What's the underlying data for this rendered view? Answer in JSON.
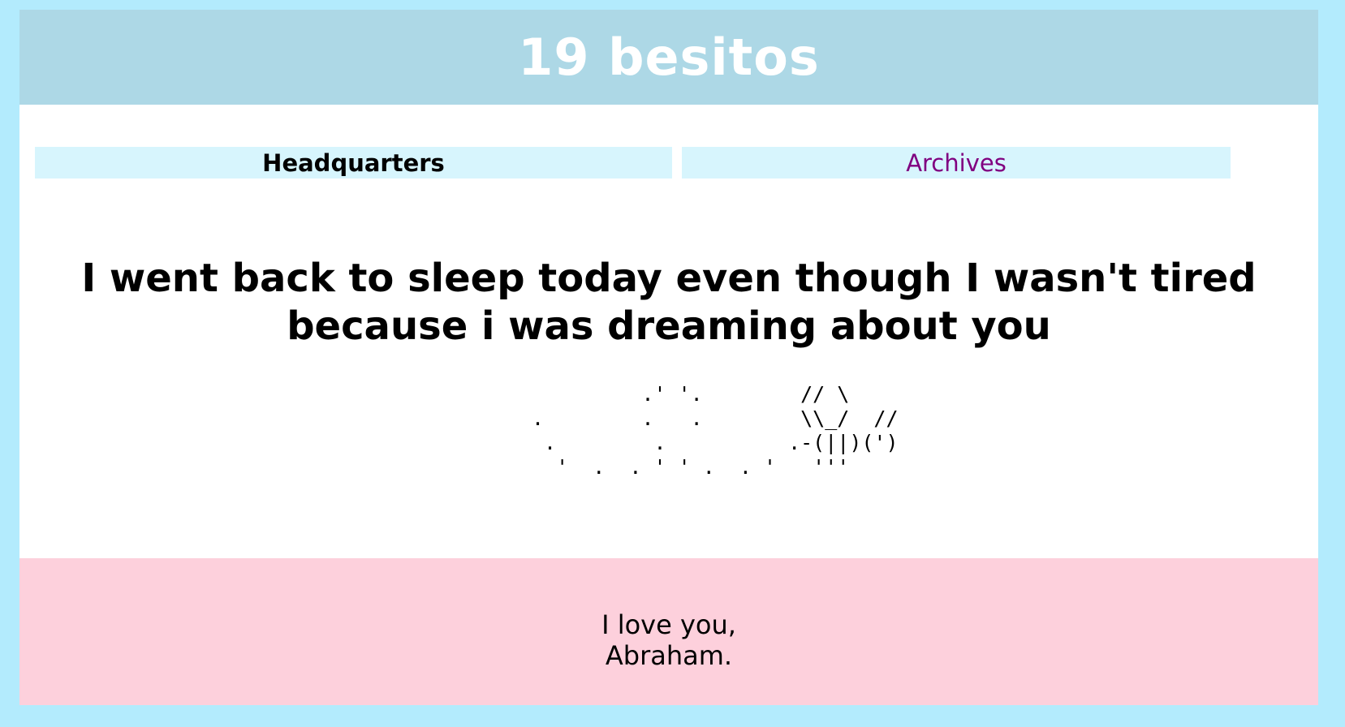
{
  "header": {
    "title": "19 besitos"
  },
  "nav": {
    "headquarters_label": "Headquarters",
    "archives_label": "Archives"
  },
  "post": {
    "title": "I went back to sleep today even though I wasn't tired because i was dreaming about you",
    "ascii_art": "         .' '.        // \\\n.        .   .        \\\\_/  //\n .        .          .-(||)(')\n  '  .  . ' ' .  . '   '''"
  },
  "footer": {
    "line1": "I love you,",
    "line2": "Abraham."
  },
  "colors": {
    "outer_background": "#b3ebfd",
    "header_background": "#add8e6",
    "nav_tab_background": "#d7f5fd",
    "visited_link": "#800080",
    "footer_background": "#fdd0dc"
  }
}
